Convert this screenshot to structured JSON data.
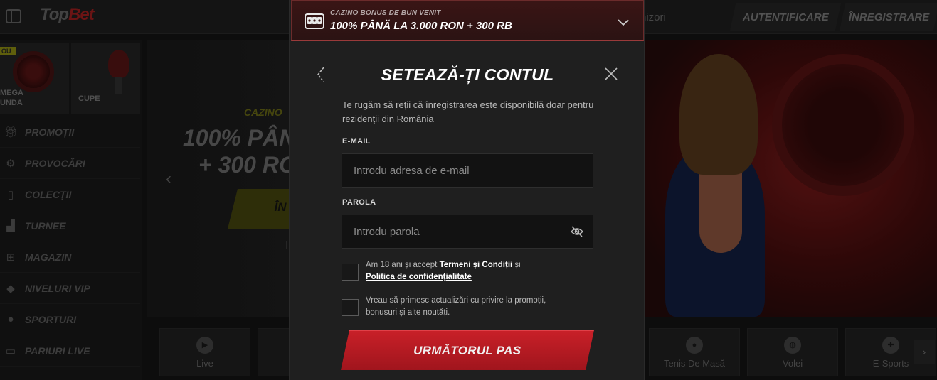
{
  "header": {
    "logo_main": "Top",
    "logo_accent": "Bet",
    "nav_partial": "nizori",
    "login_label": "AUTENTIFICARE",
    "register_label": "ÎNREGISTRARE"
  },
  "sidebar": {
    "tiles": [
      {
        "badge": "OU",
        "label": "MEGA\nUNDA"
      },
      {
        "label": "CUPE"
      }
    ],
    "items": [
      {
        "label": "PROMOȚII",
        "icon": "gift-icon"
      },
      {
        "label": "PROVOCĂRI",
        "icon": "target-icon"
      },
      {
        "label": "COLECȚII",
        "icon": "cards-icon"
      },
      {
        "label": "TURNEE",
        "icon": "podium-icon"
      },
      {
        "label": "MAGAZIN",
        "icon": "basket-icon"
      },
      {
        "label": "NIVELURI VIP",
        "icon": "diamond-icon"
      },
      {
        "label": "SPORTURI",
        "icon": "ball-icon"
      },
      {
        "label": "PARIURI LIVE",
        "icon": "live-icon"
      }
    ]
  },
  "hero": {
    "category": "CAZINO",
    "line1": "100% PÂN",
    "line2": "+ 300 RO",
    "cta": "ÎN",
    "dot": "I"
  },
  "categories": [
    {
      "label": "Live",
      "icon": "play-icon"
    },
    {
      "label": "Tenis De Masă",
      "icon": "ping-pong-icon"
    },
    {
      "label": "Volei",
      "icon": "volleyball-icon"
    },
    {
      "label": "E-Sports",
      "icon": "gamepad-icon"
    }
  ],
  "modal": {
    "bonus_subtitle": "CAZINO BONUS DE BUN VENIT",
    "bonus_title": "100% PÂNĂ LA 3.000 RON + 300 RB",
    "title": "SETEAZĂ-ȚI CONTUL",
    "notice": "Te rugăm să reții că înregistrarea este disponibilă doar pentru rezidenții din România",
    "email_label": "E-MAIL",
    "email_placeholder": "Introdu adresa de e-mail",
    "email_value": "",
    "password_label": "PAROLA",
    "password_placeholder": "Introdu parola",
    "password_value": "",
    "terms_prefix": "Am 18 ani și accept ",
    "terms_link": "Termeni și Condiții",
    "terms_mid": " și",
    "privacy_link": "Politica de confidențialitate",
    "newsletter_text": "Vreau să primesc actualizări cu privire la promoții, bonusuri și alte noutăți.",
    "next_label": "URMĂTORUL PAS"
  },
  "colors": {
    "accent_red": "#c82028",
    "bonus_bg": "#3a1515",
    "modal_bg": "#1f1f1f",
    "input_bg": "#121212"
  }
}
